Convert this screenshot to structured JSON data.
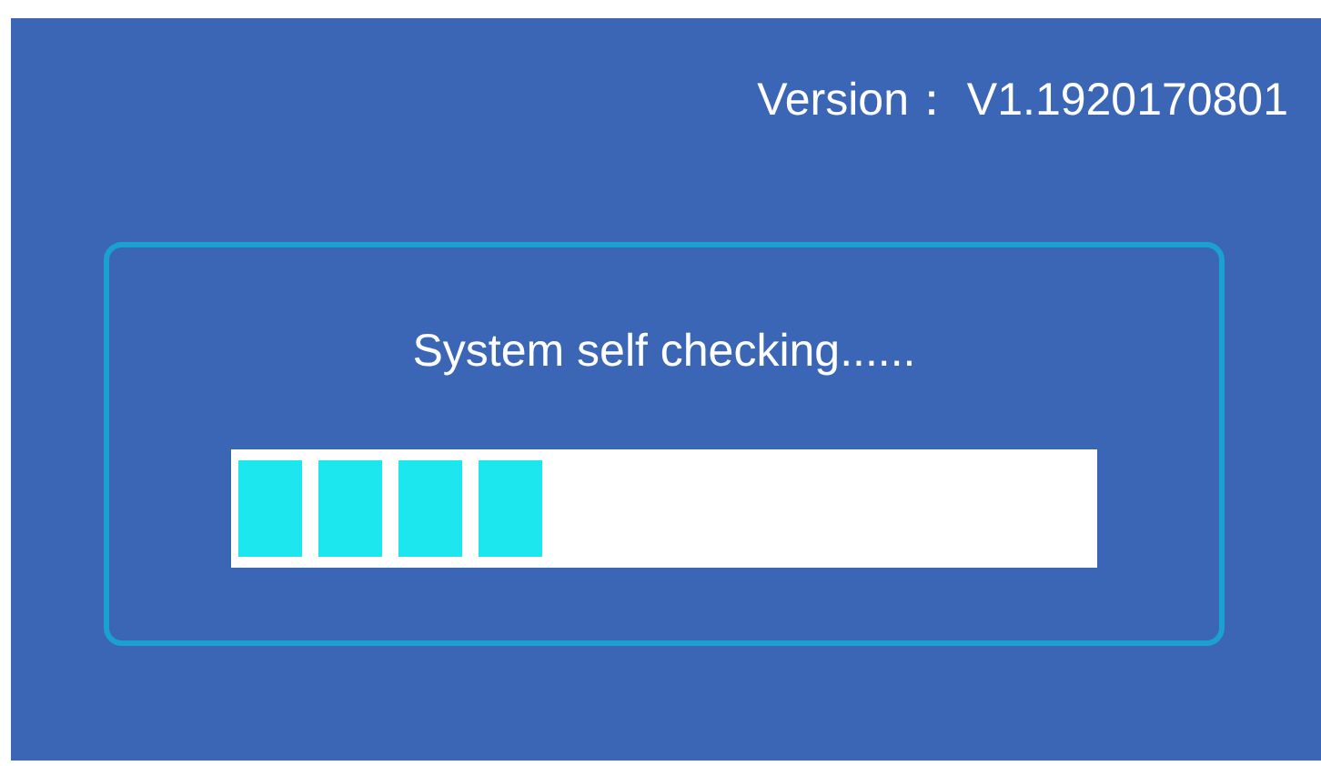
{
  "version": "Version： V1.1920170801",
  "dialog": {
    "message": "System self checking......",
    "progress": {
      "level": 0.36
    }
  }
}
